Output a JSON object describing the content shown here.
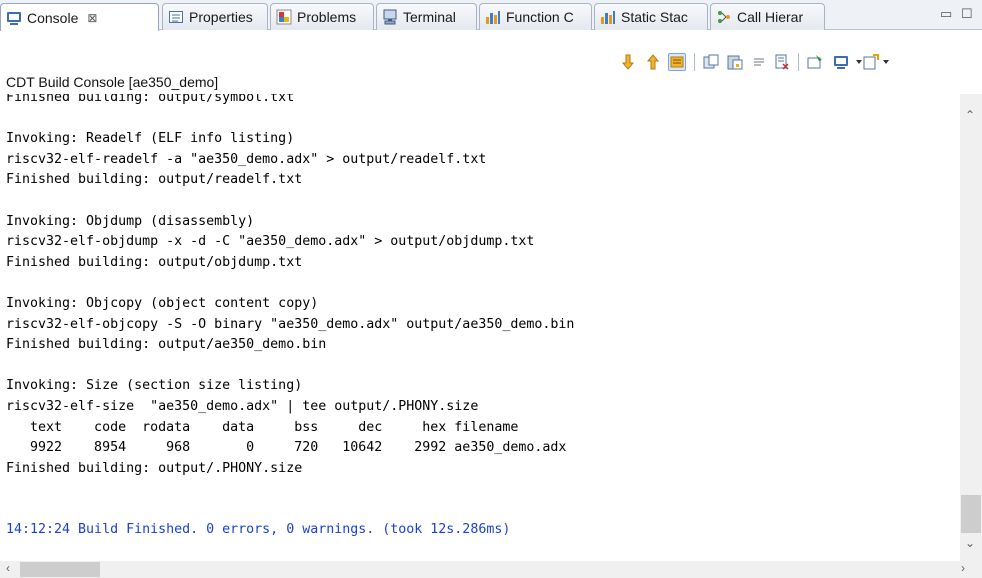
{
  "tabs": [
    {
      "label": "Console",
      "close": "⊠",
      "icon": "console-icon",
      "active": true
    },
    {
      "label": "Properties",
      "icon": "properties-icon"
    },
    {
      "label": "Problems",
      "icon": "problems-icon"
    },
    {
      "label": "Terminal",
      "icon": "terminal-icon"
    },
    {
      "label": "Function C",
      "icon": "chart-icon"
    },
    {
      "label": "Static Stac",
      "icon": "chart-icon"
    },
    {
      "label": "Call Hierar",
      "icon": "call-hierarchy-icon"
    }
  ],
  "window_controls": {
    "minimize": "▭",
    "maximize": "☐"
  },
  "toolbar": {
    "icons": [
      "scroll-down-icon",
      "scroll-up-icon",
      "scroll-lock-icon",
      "copy-icon",
      "paste-icon",
      "word-wrap-icon",
      "clear-console-icon",
      "pin-console-icon",
      "display-console-icon",
      "open-console-icon"
    ]
  },
  "console": {
    "title": "CDT Build Console [ae350_demo]",
    "lines": [
      "Finished building: output/symbol.txt",
      "",
      "Invoking: Readelf (ELF info listing)",
      "riscv32-elf-readelf -a \"ae350_demo.adx\" > output/readelf.txt",
      "Finished building: output/readelf.txt",
      "",
      "Invoking: Objdump (disassembly)",
      "riscv32-elf-objdump -x -d -C \"ae350_demo.adx\" > output/objdump.txt",
      "Finished building: output/objdump.txt",
      "",
      "Invoking: Objcopy (object content copy)",
      "riscv32-elf-objcopy -S -O binary \"ae350_demo.adx\" output/ae350_demo.bin",
      "Finished building: output/ae350_demo.bin",
      "",
      "Invoking: Size (section size listing)",
      "riscv32-elf-size  \"ae350_demo.adx\" | tee output/.PHONY.size",
      "   text    code  rodata    data     bss     dec     hex filename",
      "   9922    8954     968       0     720   10642    2992 ae350_demo.adx",
      "Finished building: output/.PHONY.size",
      "",
      "",
      "14:12:24 Build Finished. 0 errors, 0 warnings. (took 12s.286ms)"
    ],
    "status_color": "#1a3fd4"
  },
  "scrollbars": {
    "up": "⌃",
    "down": "⌄",
    "left": "‹",
    "right": "›"
  }
}
